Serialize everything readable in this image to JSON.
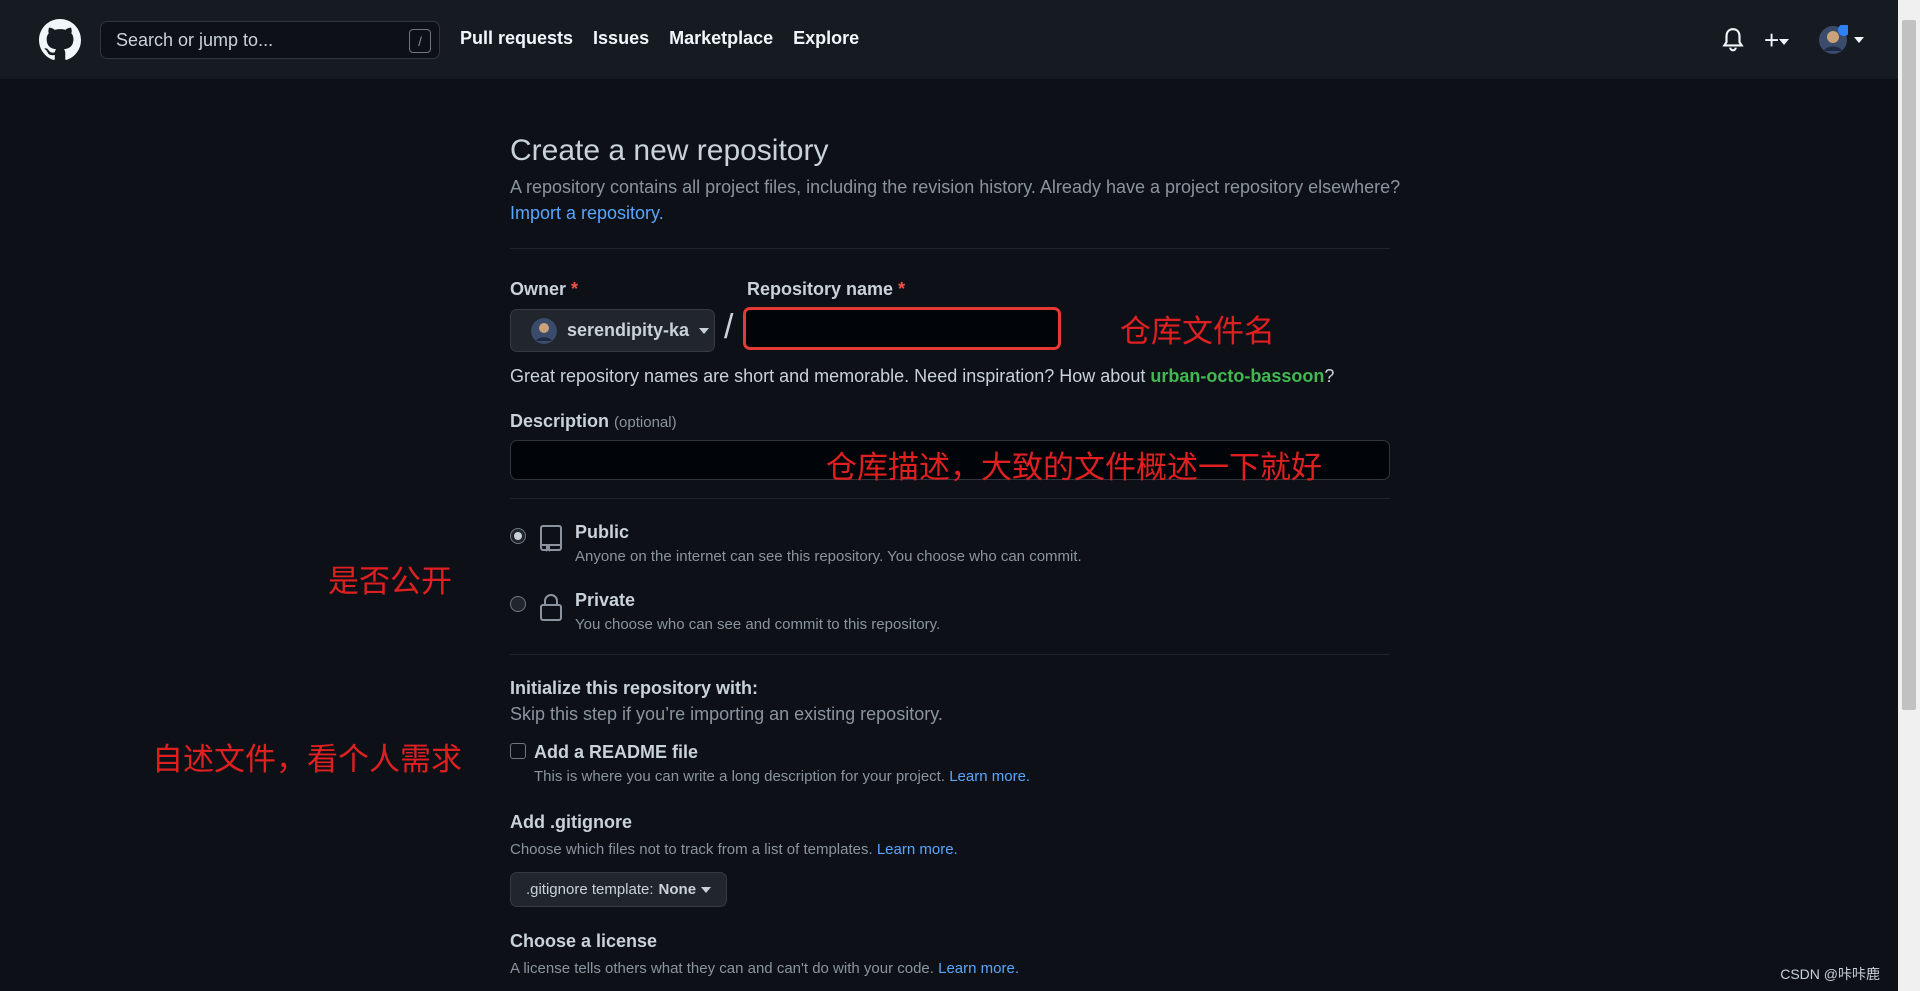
{
  "header": {
    "search_placeholder": "Search or jump to...",
    "search_key": "/",
    "nav": [
      "Pull requests",
      "Issues",
      "Marketplace",
      "Explore"
    ]
  },
  "page": {
    "title": "Create a new repository",
    "subtitle": "A repository contains all project files, including the revision history. Already have a project repository elsewhere?",
    "import_link": "Import a repository.",
    "owner_label": "Owner",
    "owner_value": "serendipity-ka",
    "repo_label": "Repository name",
    "required_mark": "*",
    "slash": "/",
    "hint_text": "Great repository names are short and memorable. Need inspiration? How about ",
    "hint_suggestion": "urban-octo-bassoon",
    "hint_end": "?",
    "desc_label": "Description",
    "desc_optional": "(optional)",
    "public_title": "Public",
    "public_desc": "Anyone on the internet can see this repository. You choose who can commit.",
    "private_title": "Private",
    "private_desc": "You choose who can see and commit to this repository.",
    "init_title": "Initialize this repository with:",
    "init_sub": "Skip this step if you’re importing an existing repository.",
    "readme_title": "Add a README file",
    "readme_desc": "This is where you can write a long description for your project.",
    "learn_more": "Learn more.",
    "gitignore_title": "Add .gitignore",
    "gitignore_desc": "Choose which files not to track from a list of templates.",
    "gitignore_btn_label": ".gitignore template:",
    "gitignore_btn_value": "None",
    "license_title": "Choose a license",
    "license_desc": "A license tells others what they can and can't do with your code."
  },
  "annotations": {
    "repo_name": "仓库文件名",
    "description": "仓库描述，大致的文件概述一下就好",
    "public": "是否公开",
    "readme": "自述文件，看个人需求"
  },
  "watermark": "CSDN @咔咔鹿",
  "colors": {
    "accent": "#58a6ff",
    "success": "#3fb950",
    "annotation": "#e02020"
  }
}
